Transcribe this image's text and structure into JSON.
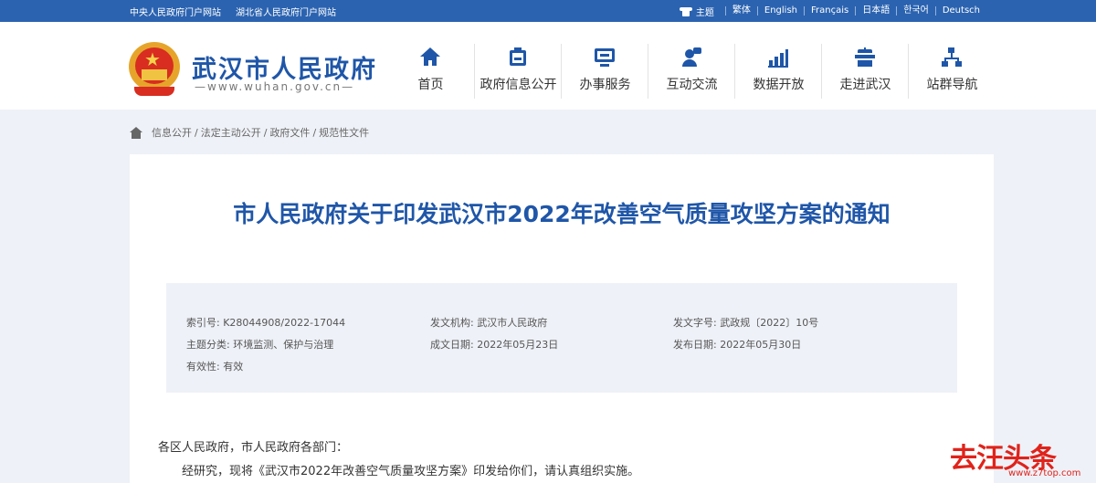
{
  "topbar": {
    "links": [
      "中央人民政府门户网站",
      "湖北省人民政府门户网站"
    ],
    "theme_label": "主题",
    "languages": [
      "繁体",
      "English",
      "Français",
      "日本語",
      "한국어",
      "Deutsch"
    ]
  },
  "header": {
    "site_title": "武汉市人民政府",
    "site_url": "—www.wuhan.gov.cn—",
    "nav": [
      {
        "label": "首页",
        "icon": "home-icon"
      },
      {
        "label": "政府信息公开",
        "icon": "info-icon"
      },
      {
        "label": "办事服务",
        "icon": "service-icon"
      },
      {
        "label": "互动交流",
        "icon": "interaction-icon"
      },
      {
        "label": "数据开放",
        "icon": "data-icon"
      },
      {
        "label": "走进武汉",
        "icon": "landmark-icon"
      },
      {
        "label": "站群导航",
        "icon": "sitemap-icon"
      }
    ]
  },
  "breadcrumb": [
    "信息公开",
    "法定主动公开",
    "政府文件",
    "规范性文件"
  ],
  "document": {
    "title": "市人民政府关于印发武汉市2022年改善空气质量攻坚方案的通知",
    "meta": {
      "index_label": "索引号:",
      "index_value": "K28044908/2022-17044",
      "issuer_label": "发文机构:",
      "issuer_value": "武汉市人民政府",
      "docno_label": "发文字号:",
      "docno_value": "武政规〔2022〕10号",
      "topic_label": "主题分类:",
      "topic_value": "环境监测、保护与治理",
      "created_label": "成文日期:",
      "created_value": "2022年05月23日",
      "published_label": "发布日期:",
      "published_value": "2022年05月30日",
      "validity_label": "有效性:",
      "validity_value": "有效"
    },
    "salutation": "各区人民政府，市人民政府各部门：",
    "paragraph1": "经研究，现将《武汉市2022年改善空气质量攻坚方案》印发给你们，请认真组织实施。"
  },
  "watermark": {
    "big": "去汪头条",
    "small": "www.z7top.com"
  },
  "colors": {
    "brand": "#1f56a8",
    "topbar": "#2b63b0",
    "page_bg": "#eef1f7"
  }
}
